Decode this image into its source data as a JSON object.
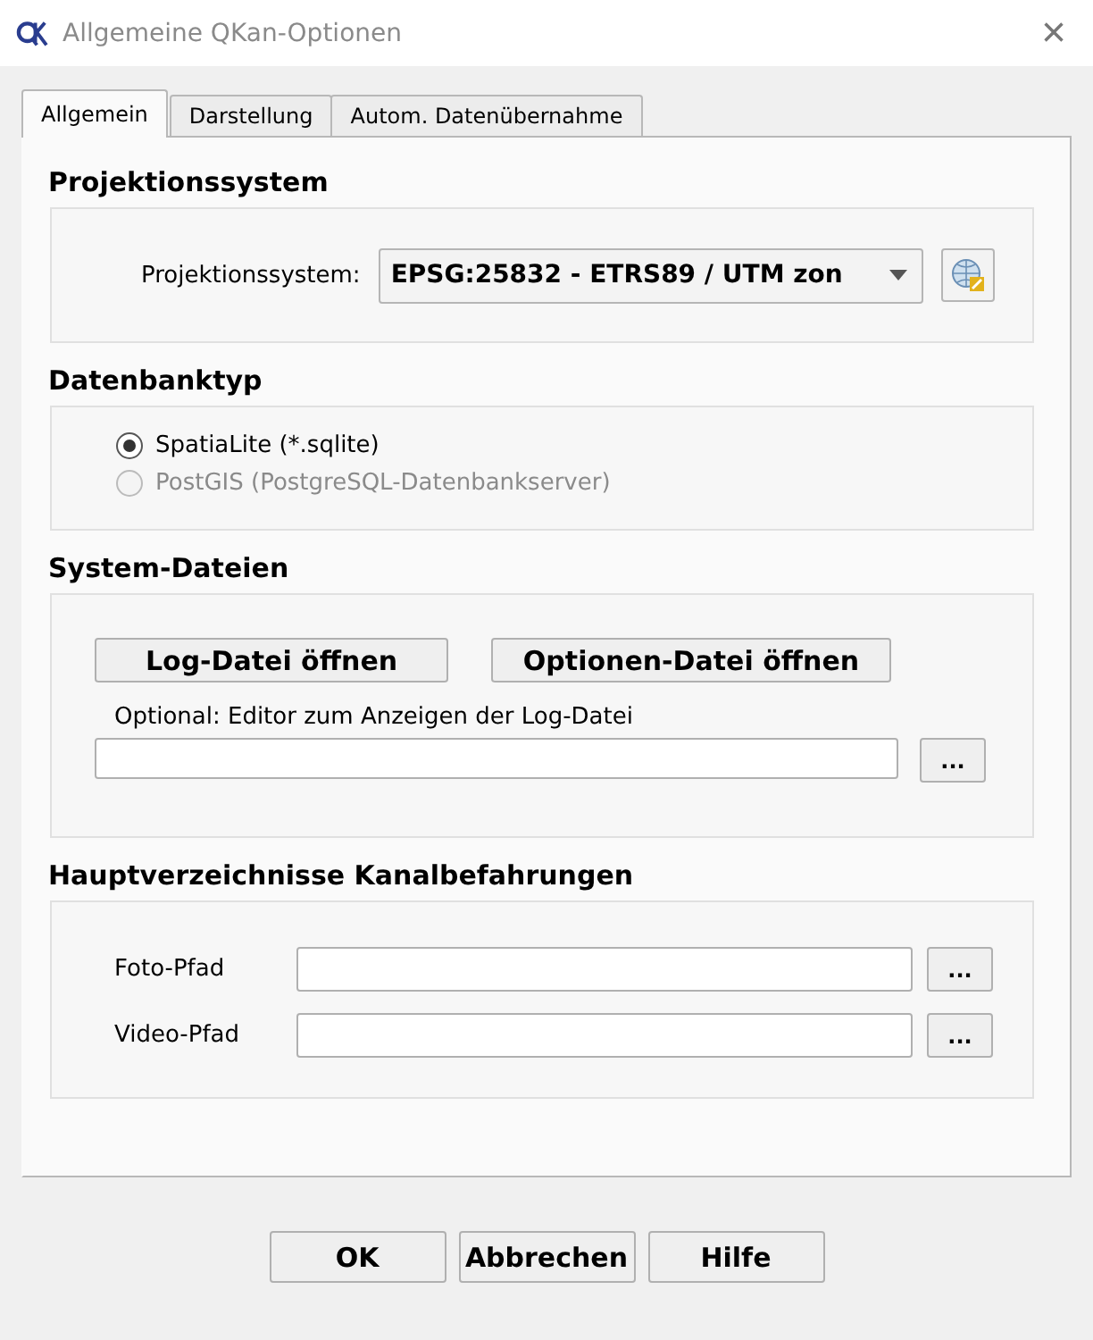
{
  "window": {
    "title": "Allgemeine QKan-Optionen",
    "close": "×"
  },
  "tabs": [
    {
      "label": "Allgemein",
      "selected": true
    },
    {
      "label": "Darstellung",
      "selected": false
    },
    {
      "label": "Autom. Datenübernahme",
      "selected": false
    }
  ],
  "projection": {
    "heading": "Projektionssystem",
    "label": "Projektionssystem:",
    "value": "EPSG:25832 - ETRS89 / UTM zon"
  },
  "database": {
    "heading": "Datenbanktyp",
    "options": [
      {
        "label": "SpatiaLite (*.sqlite)",
        "selected": true,
        "disabled": false
      },
      {
        "label": "PostGIS (PostgreSQL-Datenbankserver)",
        "selected": false,
        "disabled": true
      }
    ]
  },
  "system_files": {
    "heading": "System-Dateien",
    "buttons": [
      "Log-Datei öffnen",
      "Optionen-Datei öffnen"
    ],
    "editor_label": "Optional: Editor zum Anzeigen der Log-Datei",
    "browse": "..."
  },
  "inspection_dirs": {
    "heading": "Hauptverzeichnisse Kanalbefahrungen",
    "fields": [
      {
        "label": "Foto-Pfad",
        "browse": "..."
      },
      {
        "label": "Video-Pfad",
        "browse": "..."
      }
    ]
  },
  "buttons": [
    "OK",
    "Abbrechen",
    "Hilfe"
  ]
}
